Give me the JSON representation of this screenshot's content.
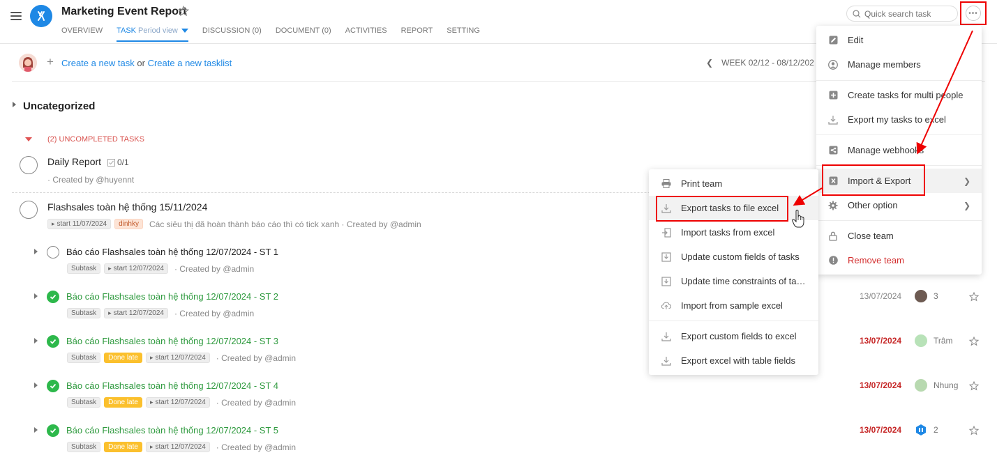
{
  "header": {
    "title": "Marketing Event Report",
    "tabs": [
      {
        "label": "OVERVIEW"
      },
      {
        "label": "TASK",
        "sub": "Period view",
        "active": true
      },
      {
        "label": "DISCUSSION (0)"
      },
      {
        "label": "DOCUMENT (0)"
      },
      {
        "label": "ACTIVITIES"
      },
      {
        "label": "REPORT"
      },
      {
        "label": "SETTING"
      }
    ],
    "search_placeholder": "Quick search task",
    "more_label": "•••"
  },
  "toolbar": {
    "create_task": "Create a new task",
    "or": "or",
    "create_tasklist": "Create a new tasklist",
    "week": "WEEK 02/12 - 08/12/202"
  },
  "group": {
    "title": "Uncategorized",
    "uncompleted_label": "(2) UNCOMPLETED TASKS"
  },
  "tasks": [
    {
      "title": "Daily Report",
      "checklist": "0/1",
      "meta": "· Created by @huyennt"
    },
    {
      "title": "Flashsales toàn hệ thống 15/11/2024",
      "start_tag": "start 11/07/2024",
      "label_tag": "dinhky",
      "meta": "Các siêu thị đã hoàn thành báo cáo thì có tick xanh · Created by @admin"
    }
  ],
  "subtasks": [
    {
      "title": "Báo cáo Flashsales toàn hệ thống 12/07/2024 - ST 1",
      "done": false,
      "subtask_tag": "Subtask",
      "start_tag": "start 12/07/2024",
      "meta": "· Created by @admin"
    },
    {
      "title": "Báo cáo Flashsales toàn hệ thống 12/07/2024 - ST 2",
      "done": true,
      "subtask_tag": "Subtask",
      "start_tag": "start 12/07/2024",
      "meta": "· Created by @admin",
      "date": "13/07/2024",
      "assignee": "3"
    },
    {
      "title": "Báo cáo Flashsales toàn hệ thống 12/07/2024 - ST 3",
      "done": true,
      "subtask_tag": "Subtask",
      "late_tag": "Done late",
      "start_tag": "start 12/07/2024",
      "meta": "· Created by @admin",
      "date": "13/07/2024",
      "assignee": "Trâm"
    },
    {
      "title": "Báo cáo Flashsales toàn hệ thống 12/07/2024 - ST 4",
      "done": true,
      "subtask_tag": "Subtask",
      "late_tag": "Done late",
      "start_tag": "start 12/07/2024",
      "meta": "· Created by @admin",
      "date": "13/07/2024",
      "assignee": "Nhung"
    },
    {
      "title": "Báo cáo Flashsales toàn hệ thống 12/07/2024 - ST 5",
      "done": true,
      "subtask_tag": "Subtask",
      "late_tag": "Done late",
      "start_tag": "start 12/07/2024",
      "meta": "· Created by @admin",
      "date": "13/07/2024",
      "assignee": "2"
    }
  ],
  "main_menu": {
    "items": [
      {
        "label": "Edit",
        "icon": "pencil-icon"
      },
      {
        "label": "Manage members",
        "icon": "user-circle-icon"
      },
      {
        "label": "Create tasks for multi people",
        "icon": "plus-square-icon"
      },
      {
        "label": "Export my tasks to excel",
        "icon": "download-icon"
      },
      {
        "label": "Manage webhooks",
        "icon": "share-icon"
      },
      {
        "label": "Import & Export",
        "icon": "excel-icon"
      },
      {
        "label": "Other option",
        "icon": "gear-icon"
      },
      {
        "label": "Close team",
        "icon": "lock-icon"
      },
      {
        "label": "Remove team",
        "icon": "alert-circle-icon"
      }
    ]
  },
  "sub_menu": {
    "items": [
      {
        "label": "Print team",
        "icon": "printer-icon"
      },
      {
        "label": "Export tasks to file excel",
        "icon": "download-icon"
      },
      {
        "label": "Import tasks from excel",
        "icon": "import-icon"
      },
      {
        "label": "Update custom fields of tasks",
        "icon": "download-icon"
      },
      {
        "label": "Update time constraints of tasks",
        "icon": "download-icon"
      },
      {
        "label": "Import from sample excel",
        "icon": "cloud-upload-icon"
      },
      {
        "label": "Export custom fields to excel",
        "icon": "download-icon"
      },
      {
        "label": "Export excel with table fields",
        "icon": "download-icon"
      }
    ]
  },
  "colors": {
    "accent": "#1e88e5",
    "done": "#2db84b",
    "late": "#c62828",
    "annotation": "#ee0000",
    "done_late_tag": "#fbc02d"
  }
}
